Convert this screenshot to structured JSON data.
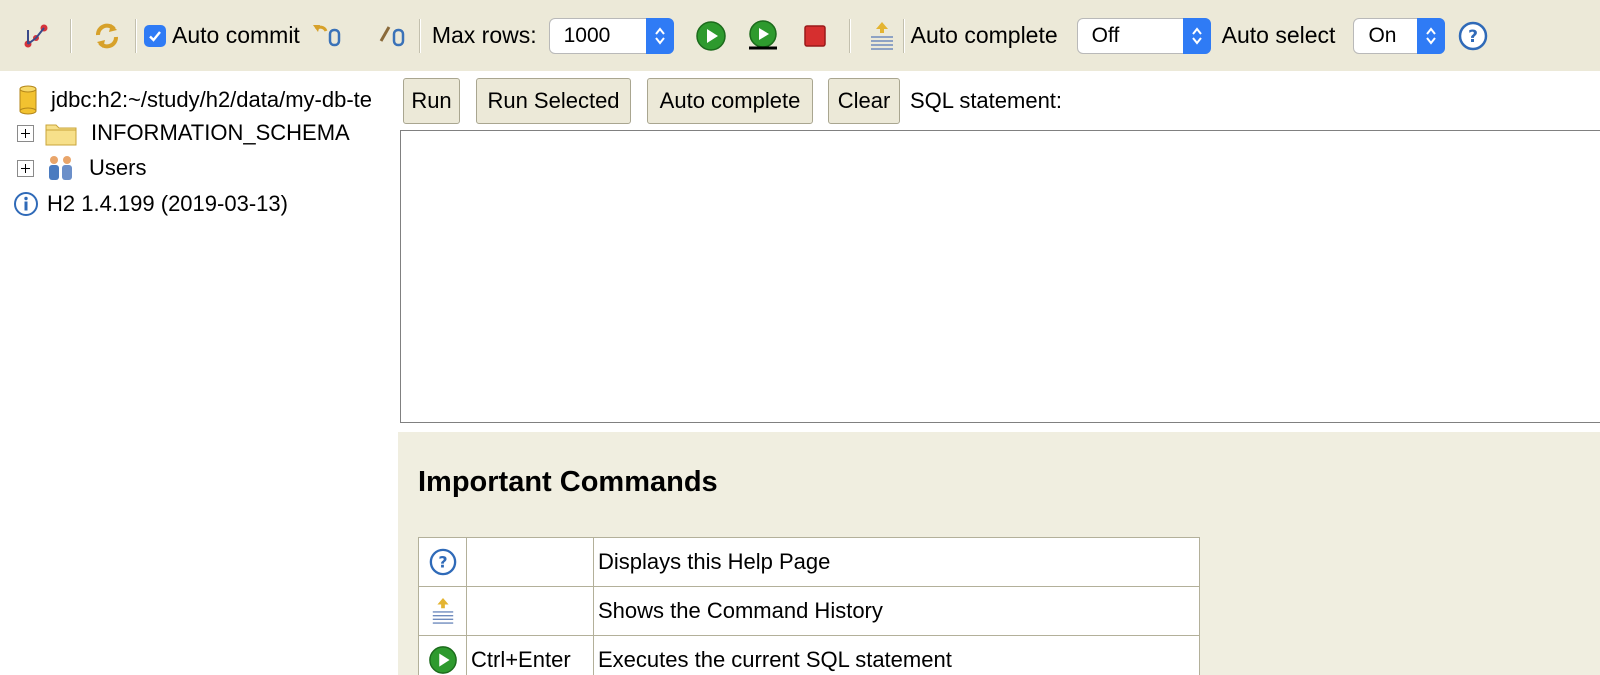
{
  "toolbar": {
    "auto_commit_label": "Auto commit",
    "auto_commit_checked": true,
    "max_rows_label": "Max rows:",
    "max_rows_value": "1000",
    "auto_complete_label": "Auto complete",
    "auto_complete_value": "Off",
    "auto_select_label": "Auto select",
    "auto_select_value": "On"
  },
  "tree": {
    "connection": "jdbc:h2:~/study/h2/data/my-db-te",
    "items": [
      {
        "label": "INFORMATION_SCHEMA",
        "icon": "folder-icon"
      },
      {
        "label": "Users",
        "icon": "users-icon"
      }
    ],
    "version": "H2 1.4.199 (2019-03-13)"
  },
  "query": {
    "run_label": "Run",
    "run_selected_label": "Run Selected",
    "auto_complete_label": "Auto complete",
    "clear_label": "Clear",
    "sql_statement_label": "SQL statement:",
    "sql_text": ""
  },
  "help": {
    "title": "Important Commands",
    "rows": [
      {
        "icon": "help-icon",
        "shortcut": "",
        "description": "Displays this Help Page"
      },
      {
        "icon": "history-icon",
        "shortcut": "",
        "description": "Shows the Command History"
      },
      {
        "icon": "run-icon",
        "shortcut": "Ctrl+Enter",
        "description": "Executes the current SQL statement"
      }
    ]
  },
  "colors": {
    "toolbar_bg": "#ece9d8",
    "help_bg": "#f0eee0",
    "accent_blue": "#2f7bf5",
    "run_green": "#2e9a2e",
    "stop_red": "#d62f2f"
  }
}
